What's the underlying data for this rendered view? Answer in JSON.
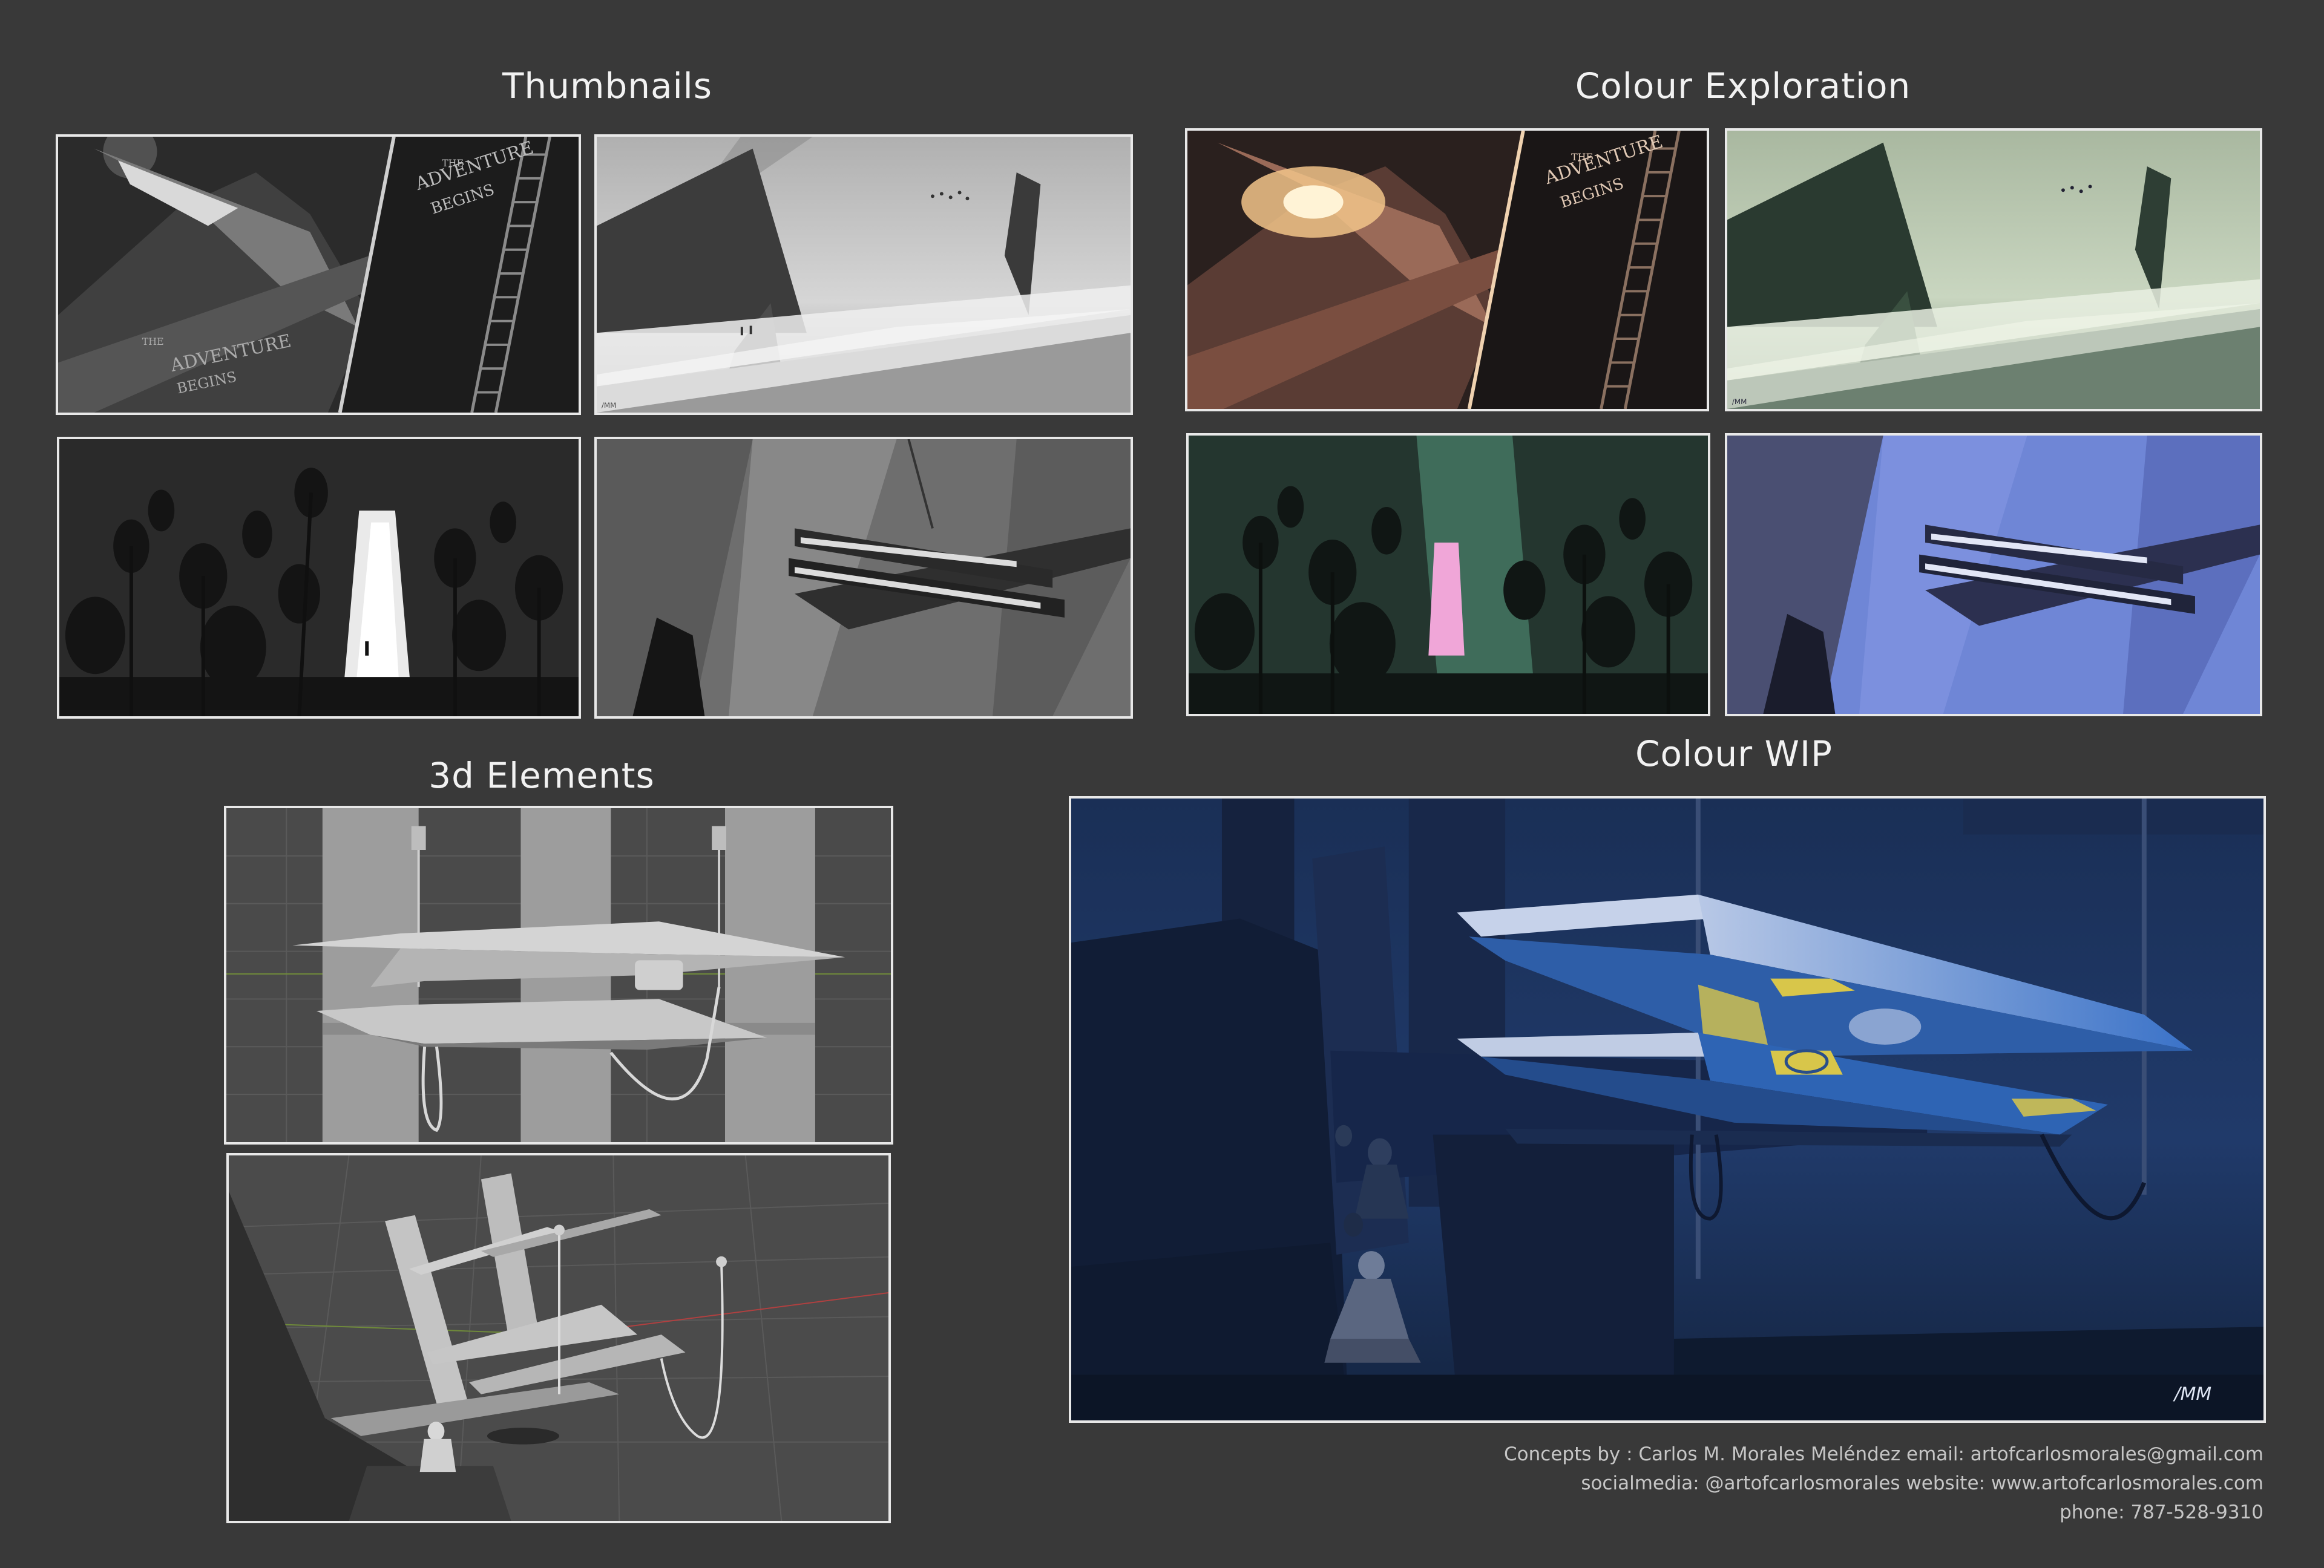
{
  "sections": {
    "thumbnails": {
      "title": "Thumbnails"
    },
    "colour_exploration": {
      "title": "Colour Exploration"
    },
    "elements_3d": {
      "title": "3d Elements"
    },
    "colour_wip": {
      "title": "Colour WIP"
    }
  },
  "panel_text": {
    "adventure_line1": "THE",
    "adventure_line2": "ADVENTURE",
    "adventure_line3": "BEGINS",
    "signature": "/MM"
  },
  "credits": {
    "line1": "Concepts by : Carlos M. Morales Meléndez    email: artofcarlosmorales@gmail.com",
    "line2": "socialmedia: @artofcarlosmorales   website: www.artofcarlosmorales.com",
    "line3": "phone: 787-528-9310"
  },
  "colors": {
    "background": "#393939",
    "frame": "#e8e8e8",
    "title_text": "#f2f2f2",
    "credit_text": "#c6c6c6",
    "wip_blue": "#2a5ea8",
    "ship_yellow": "#d8c64a"
  }
}
